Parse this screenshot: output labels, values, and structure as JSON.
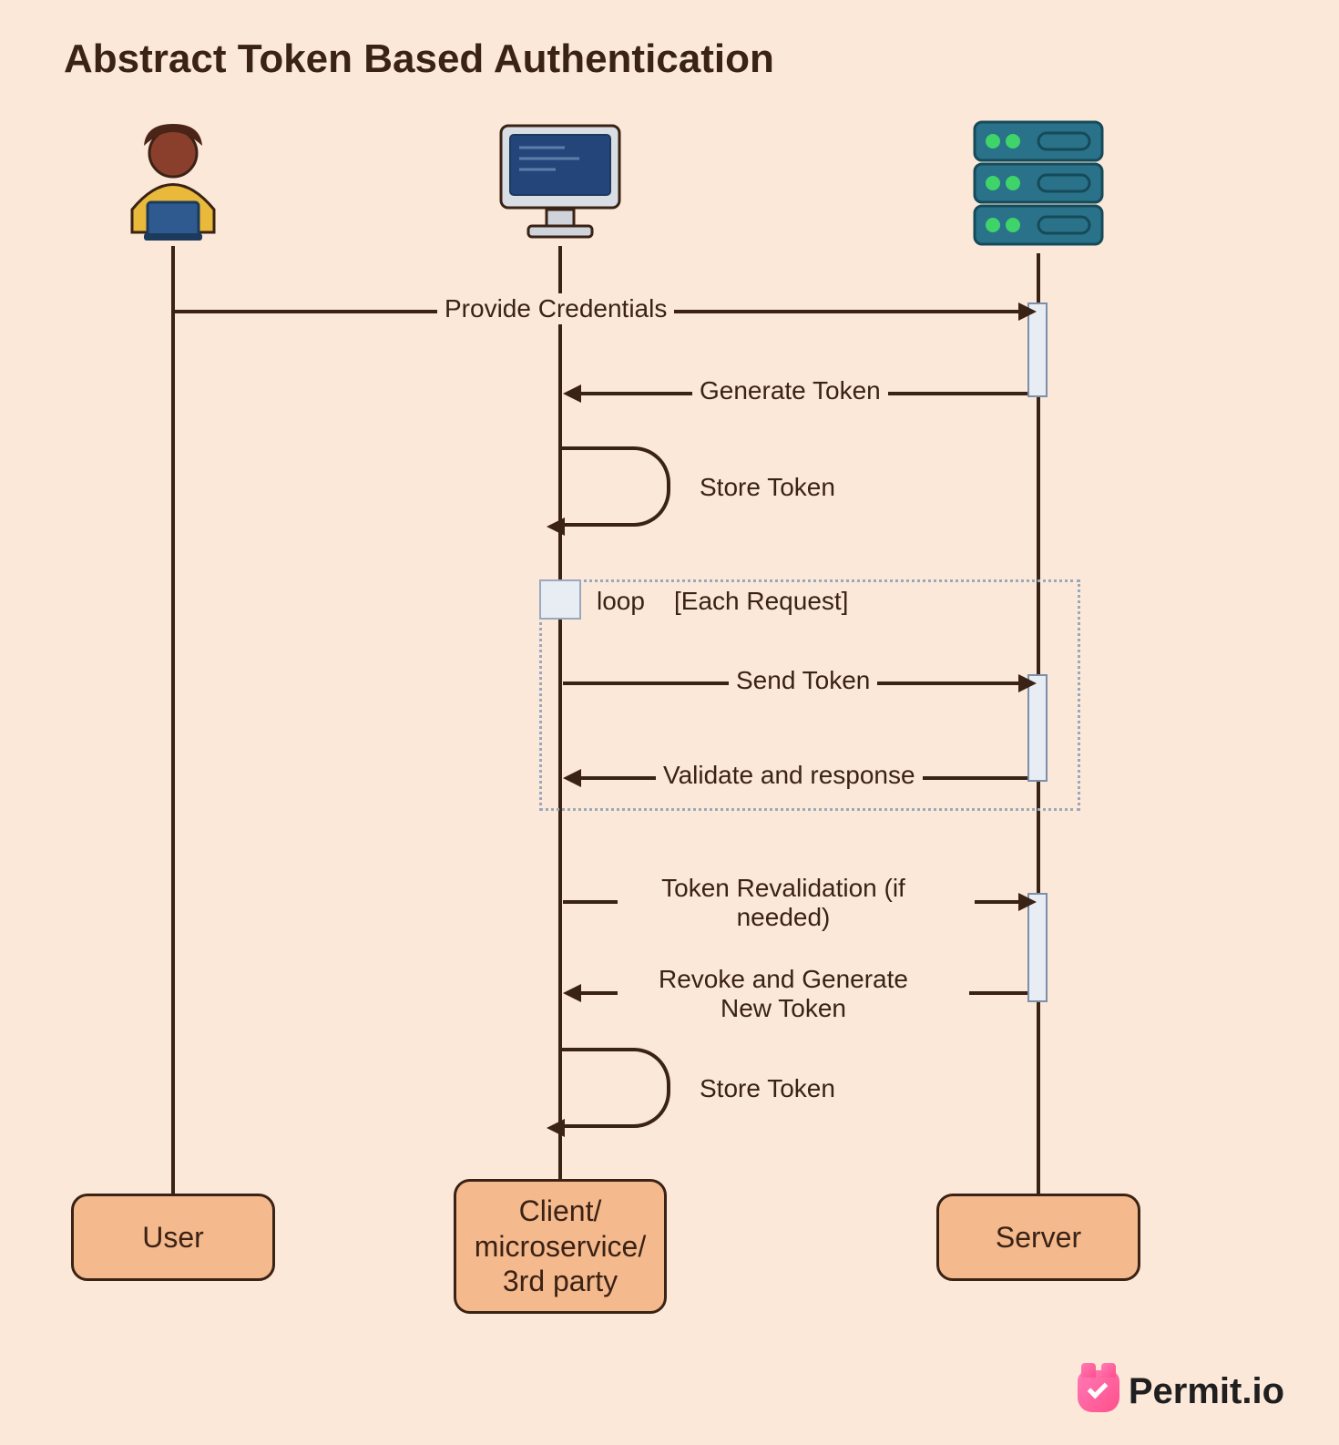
{
  "title": "Abstract Token Based Authentication",
  "actors": {
    "user": "User",
    "client": "Client/\nmicroservice/\n3rd party",
    "server": "Server"
  },
  "loop": {
    "keyword": "loop",
    "condition": "[Each Request]"
  },
  "messages": {
    "provide_credentials": "Provide Credentials",
    "generate_token": "Generate Token",
    "store_token_1": "Store Token",
    "send_token": "Send Token",
    "validate_response": "Validate and response",
    "revalidation": "Token Revalidation (if needed)",
    "revoke_new": "Revoke and Generate New Token",
    "store_token_2": "Store Token"
  },
  "brand": "Permit.io",
  "chart_data": {
    "type": "sequence-diagram",
    "title": "Abstract Token Based Authentication",
    "participants": [
      "User",
      "Client/microservice/3rd party",
      "Server"
    ],
    "steps": [
      {
        "from": "User",
        "to": "Server",
        "label": "Provide Credentials",
        "kind": "sync"
      },
      {
        "from": "Server",
        "to": "Client/microservice/3rd party",
        "label": "Generate Token",
        "kind": "sync"
      },
      {
        "from": "Client/microservice/3rd party",
        "to": "Client/microservice/3rd party",
        "label": "Store Token",
        "kind": "self"
      },
      {
        "fragment": "loop",
        "condition": "Each Request",
        "steps": [
          {
            "from": "Client/microservice/3rd party",
            "to": "Server",
            "label": "Send Token",
            "kind": "sync"
          },
          {
            "from": "Server",
            "to": "Client/microservice/3rd party",
            "label": "Validate and response",
            "kind": "sync"
          }
        ]
      },
      {
        "from": "Client/microservice/3rd party",
        "to": "Server",
        "label": "Token Revalidation (if needed)",
        "kind": "sync"
      },
      {
        "from": "Server",
        "to": "Client/microservice/3rd party",
        "label": "Revoke and Generate New Token",
        "kind": "sync"
      },
      {
        "from": "Client/microservice/3rd party",
        "to": "Client/microservice/3rd party",
        "label": "Store Token",
        "kind": "self"
      }
    ]
  }
}
